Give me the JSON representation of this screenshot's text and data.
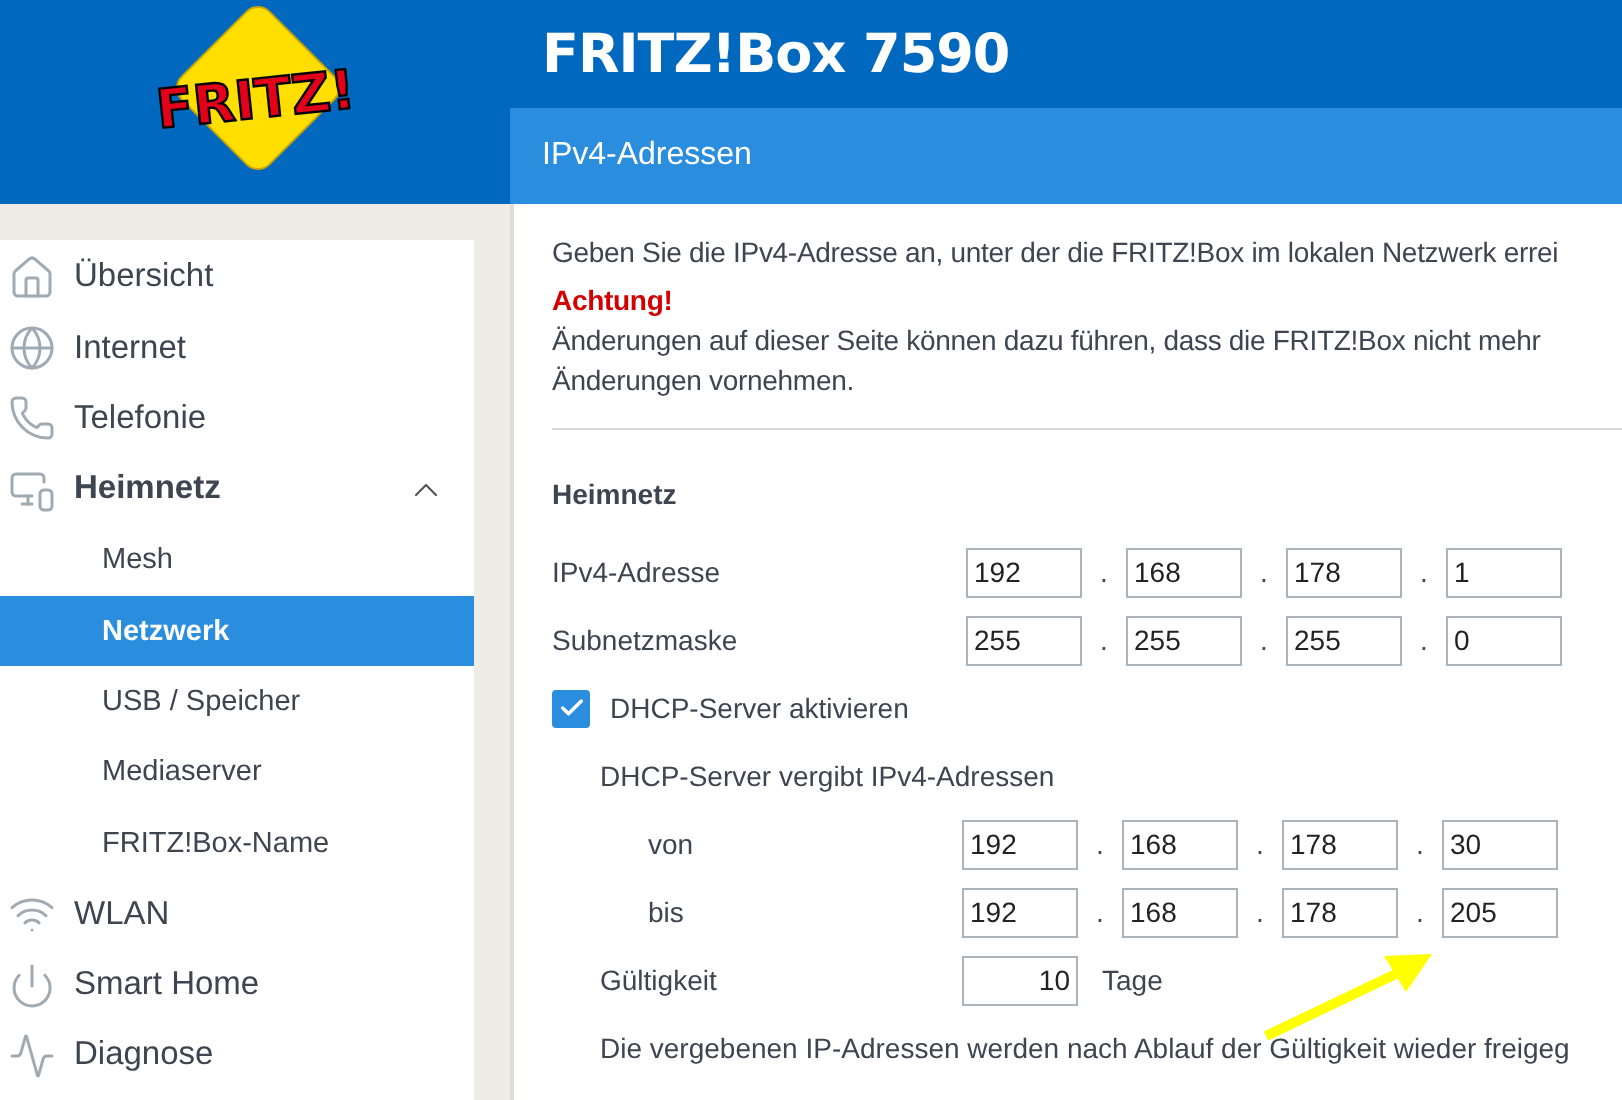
{
  "header": {
    "logo": "FRITZ!",
    "title": "FRITZ!Box 7590",
    "subtitle": "IPv4-Adressen"
  },
  "sidebar": {
    "items": [
      {
        "label": "Übersicht",
        "selected": false
      },
      {
        "label": "Internet",
        "selected": false
      },
      {
        "label": "Telefonie",
        "selected": false
      },
      {
        "label": "Heimnetz",
        "selected": false,
        "expanded": true,
        "children": [
          {
            "label": "Mesh",
            "selected": false
          },
          {
            "label": "Netzwerk",
            "selected": true
          },
          {
            "label": "USB / Speicher",
            "selected": false
          },
          {
            "label": "Mediaserver",
            "selected": false
          },
          {
            "label": "FRITZ!Box-Name",
            "selected": false
          }
        ]
      },
      {
        "label": "WLAN",
        "selected": false
      },
      {
        "label": "Smart Home",
        "selected": false
      },
      {
        "label": "Diagnose",
        "selected": false
      }
    ]
  },
  "content": {
    "intro": "Geben Sie die IPv4-Adresse an, unter der die FRITZ!Box im lokalen Netzwerk errei",
    "warning_title": "Achtung!",
    "warning_lines": [
      "Änderungen auf dieser Seite können dazu führen, dass die FRITZ!Box nicht mehr",
      "Änderungen vornehmen."
    ],
    "section_title": "Heimnetz",
    "octet_separator": ".",
    "address_rows": [
      {
        "label": "IPv4-Adresse",
        "octets": [
          "192",
          "168",
          "178",
          "1"
        ]
      },
      {
        "label": "Subnetzmaske",
        "octets": [
          "255",
          "255",
          "255",
          "0"
        ]
      }
    ],
    "dhcp": {
      "label": "DHCP-Server aktivieren",
      "checked": true
    },
    "range_title": "DHCP-Server vergibt IPv4-Adressen",
    "range_rows": [
      {
        "label": "von",
        "octets": [
          "192",
          "168",
          "178",
          "30"
        ]
      },
      {
        "label": "bis",
        "octets": [
          "192",
          "168",
          "178",
          "205"
        ]
      }
    ],
    "validity": {
      "label": "Gültigkeit",
      "value": "10",
      "unit": "Tage"
    },
    "note": "Die vergebenen IP-Adressen werden nach Ablauf der Gültigkeit wieder freigeg"
  }
}
